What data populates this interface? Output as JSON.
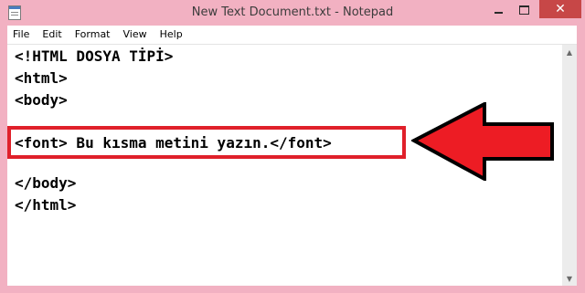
{
  "window": {
    "title": "New Text Document.txt - Notepad",
    "frame_color": "#f2b1c2",
    "close_color": "#c74747",
    "icons": {
      "app": "notepad-icon",
      "minimize": "minimize-icon",
      "maximize": "maximize-icon",
      "close": "close-icon"
    },
    "close_glyph": "✕"
  },
  "menubar": {
    "items": [
      "File",
      "Edit",
      "Format",
      "View",
      "Help"
    ]
  },
  "editor": {
    "lines": [
      "<!HTML DOSYA TİPİ>",
      "<html>",
      "<body>",
      "",
      "<font> Bu kısma metini yazın.</font>",
      "",
      "</body>",
      "</html>"
    ],
    "highlighted_line_index": 4,
    "highlight_color": "#e0202a"
  },
  "scrollbar": {
    "up_glyph": "▲",
    "down_glyph": "▼"
  }
}
